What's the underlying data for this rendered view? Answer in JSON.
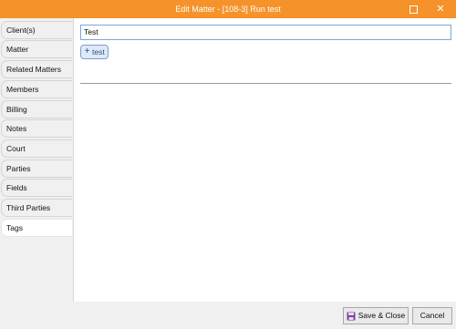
{
  "window": {
    "title": "Edit Matter - [108-3] Run test"
  },
  "sidebar": {
    "tabs": [
      {
        "label": "Client(s)"
      },
      {
        "label": "Matter"
      },
      {
        "label": "Related Matters"
      },
      {
        "label": "Members"
      },
      {
        "label": "Billing"
      },
      {
        "label": "Notes"
      },
      {
        "label": "Court"
      },
      {
        "label": "Parties"
      },
      {
        "label": "Fields"
      },
      {
        "label": "Third Parties"
      },
      {
        "label": "Tags"
      }
    ],
    "active_tab": "Tags"
  },
  "tags": {
    "input_value": "Test",
    "chips": [
      {
        "label": "test"
      }
    ]
  },
  "footer": {
    "save_label": "Save & Close",
    "cancel_label": "Cancel"
  },
  "icons": {
    "maximize": "maximize-icon",
    "close": "close-icon",
    "save": "floppy-disk-icon",
    "add": "plus-icon"
  },
  "colors": {
    "titlebar": "#f5932a",
    "save_icon": "#7b3f9e"
  }
}
